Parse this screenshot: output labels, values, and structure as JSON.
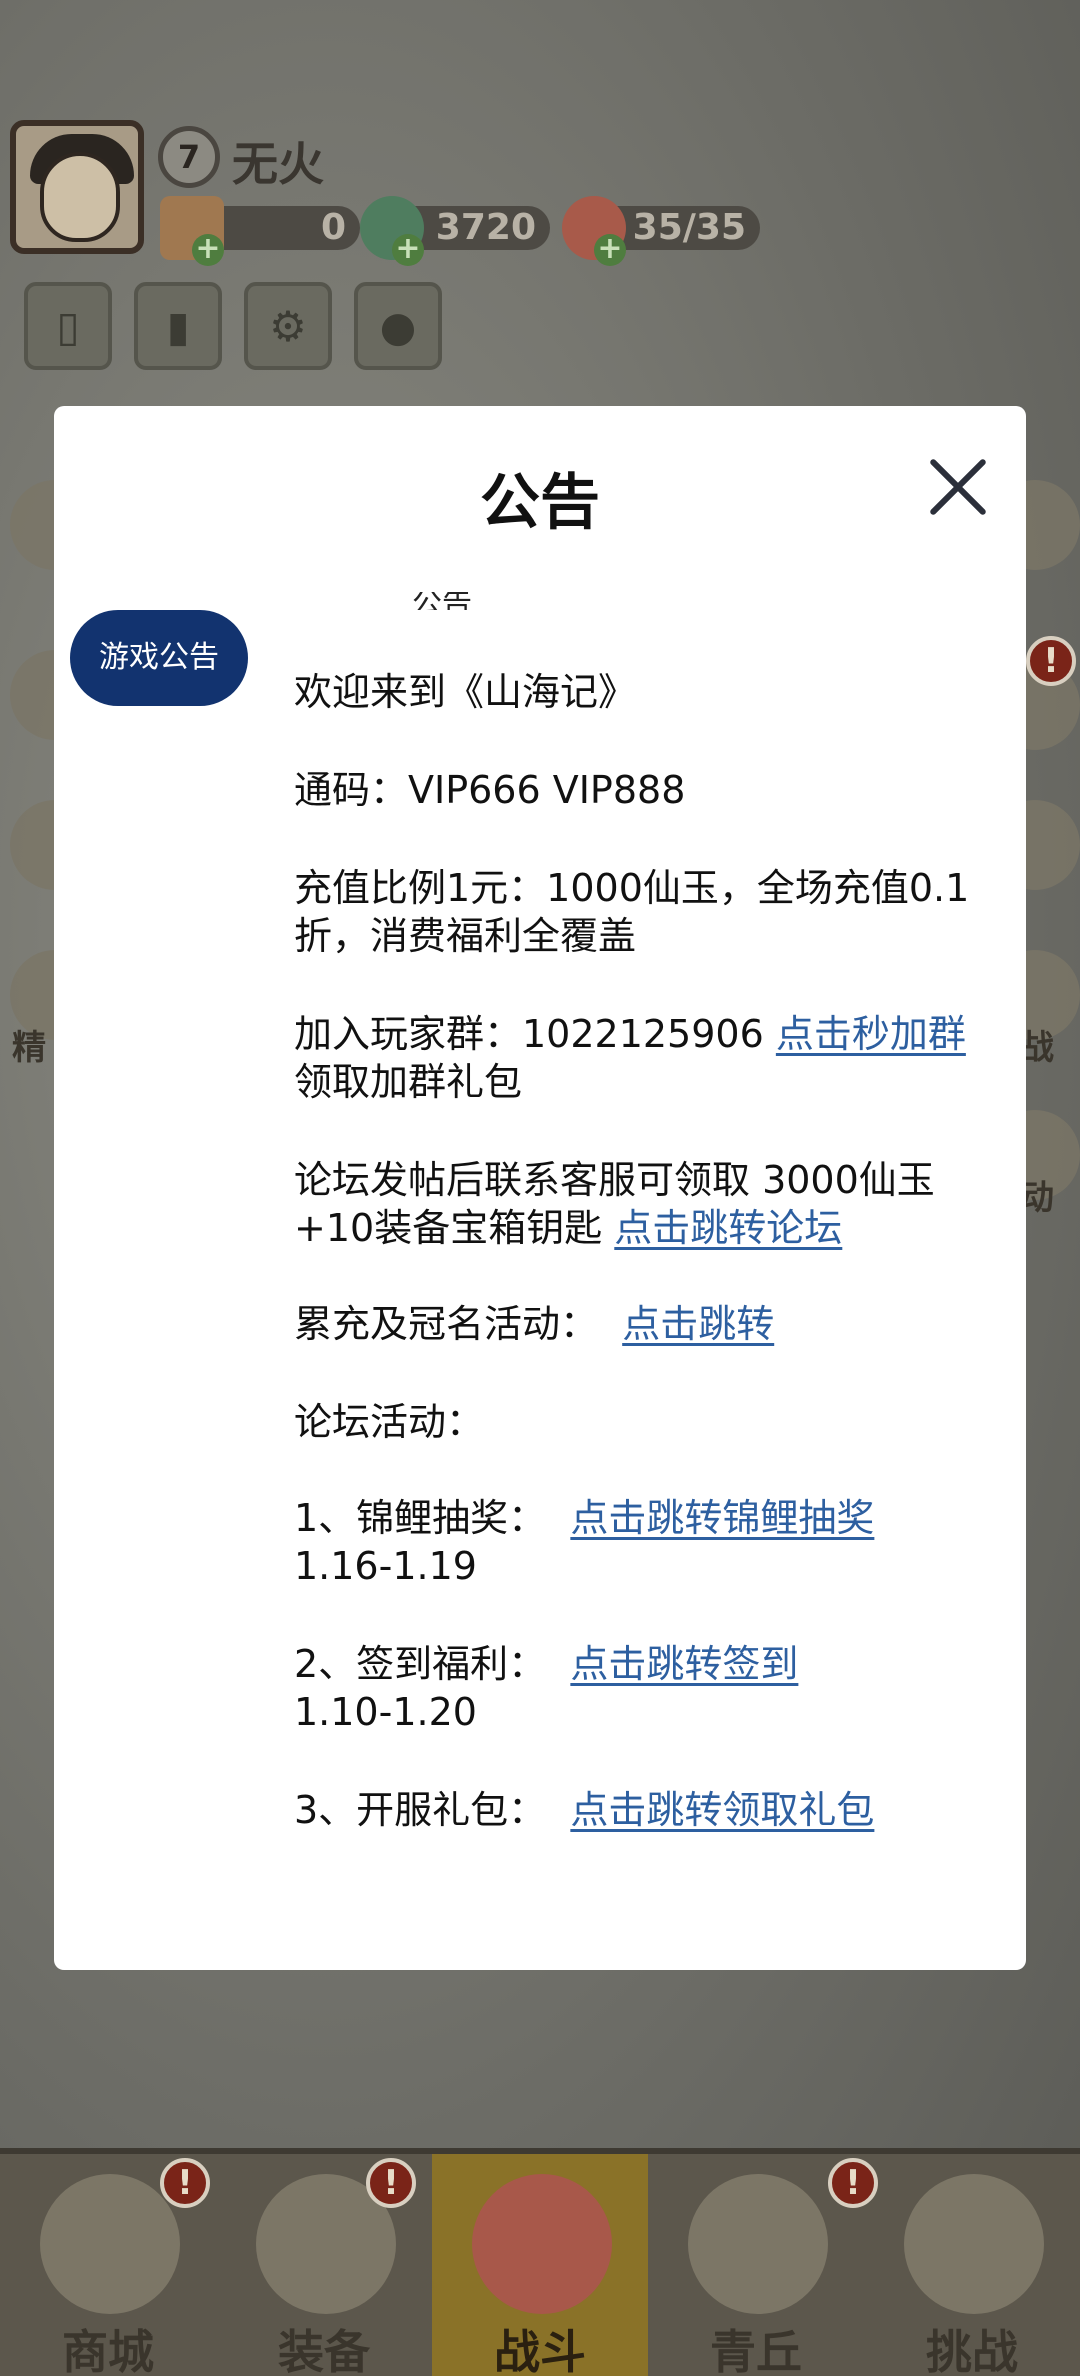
{
  "game": {
    "player": {
      "level": "7",
      "name": "无火"
    },
    "resources": [
      {
        "value": "0",
        "icon": "gift-icon"
      },
      {
        "value": "3720",
        "icon": "jade-dragon-icon"
      },
      {
        "value": "35/35",
        "icon": "peach-stamina-icon"
      }
    ],
    "side_labels": {
      "left": "精",
      "right_1": "战",
      "right_2": "动"
    },
    "badge_mark": "!",
    "nav": [
      {
        "label": "商城",
        "icon": "shop-icon"
      },
      {
        "label": "装备",
        "icon": "armor-icon"
      },
      {
        "label": "战斗",
        "icon": "crossed-swords-icon"
      },
      {
        "label": "青丘",
        "icon": "mountain-icon"
      },
      {
        "label": "挑战",
        "icon": "orb-icon"
      }
    ]
  },
  "modal": {
    "title": "公告",
    "tab": "游戏公告",
    "clipped_heading": "公告",
    "lines": {
      "welcome": "欢迎来到《山海记》",
      "code": "通码：VIP666 VIP888",
      "recharge": "充值比例1元：1000仙玉，全场充值0.1折，消费福利全覆盖",
      "group_prefix": "加入玩家群：1022125906 ",
      "group_link": "点击秒加群",
      "group_suffix": " 领取加群礼包",
      "forum_text": "论坛发帖后联系客服可领取 3000仙玉+10装备宝箱钥匙 ",
      "forum_link": "点击跳转论坛",
      "cumulative_text": "累充及冠名活动： ",
      "cumulative_link": "点击跳转",
      "forum_activity": "论坛活动：",
      "act1_text": "1、锦鲤抽奖： ",
      "act1_link": "点击跳转锦鲤抽奖",
      "act1_date": "1.16-1.19",
      "act2_text": "2、签到福利： ",
      "act2_link": "点击跳转签到",
      "act2_date": "1.10-1.20",
      "act3_text": "3、开服礼包： ",
      "act3_link": "点击跳转领取礼包"
    }
  },
  "colors": {
    "tab_bg": "#12336f",
    "link": "#2d5fa0",
    "modal_bg": "#ffffff"
  }
}
